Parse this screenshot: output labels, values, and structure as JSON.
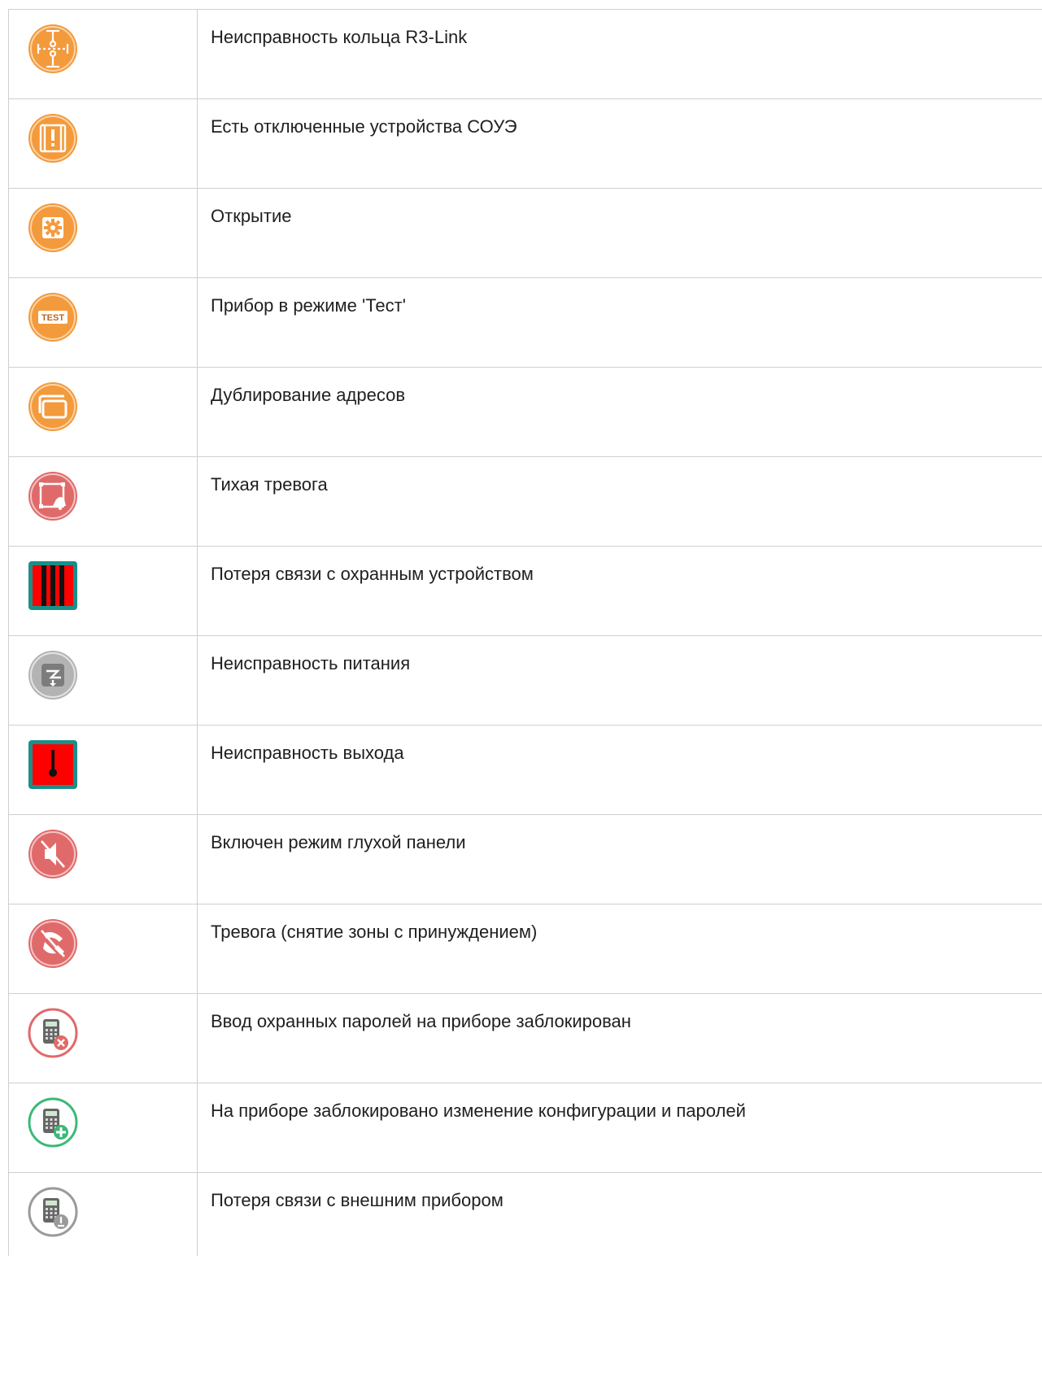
{
  "rows": [
    {
      "icon": "ring-fault-icon",
      "color": "#f39a3c",
      "label": "Неисправность кольца R3-Link"
    },
    {
      "icon": "disabled-devices-icon",
      "color": "#f39a3c",
      "label": "Есть отключенные устройства СОУЭ"
    },
    {
      "icon": "gear-icon",
      "color": "#f39a3c",
      "label": "Открытие"
    },
    {
      "icon": "test-mode-icon",
      "color": "#f39a3c",
      "label": "Прибор в режиме 'Тест'",
      "badge_text": "TEST"
    },
    {
      "icon": "duplicate-windows-icon",
      "color": "#f39a3c",
      "label": "Дублирование адресов"
    },
    {
      "icon": "silent-alarm-icon",
      "color": "#e06a6a",
      "label": "Тихая тревога"
    },
    {
      "icon": "connection-lost-bars-icon",
      "color": "#ff0000",
      "label": "Потеря связи с охранным устройством"
    },
    {
      "icon": "power-fault-icon",
      "color": "#9a9a9a",
      "label": "Неисправность питания"
    },
    {
      "icon": "output-fault-icon",
      "color": "#ff0000",
      "label": "Неисправность выхода"
    },
    {
      "icon": "muted-speaker-icon",
      "color": "#e06a6a",
      "label": "Включен режим глухой панели"
    },
    {
      "icon": "duress-alarm-icon",
      "color": "#e06a6a",
      "label": "Тревога (снятие зоны с принуждением)"
    },
    {
      "icon": "keypad-blocked-icon",
      "color": "#e06a6a",
      "label": "Ввод охранных паролей на приборе заблокирован"
    },
    {
      "icon": "keypad-config-locked-icon",
      "color": "#3cb878",
      "label": "На приборе заблокировано изменение конфигурации и паролей"
    },
    {
      "icon": "keypad-connection-lost-icon",
      "color": "#9a9a9a",
      "label": "Потеря связи с внешним прибором"
    }
  ]
}
